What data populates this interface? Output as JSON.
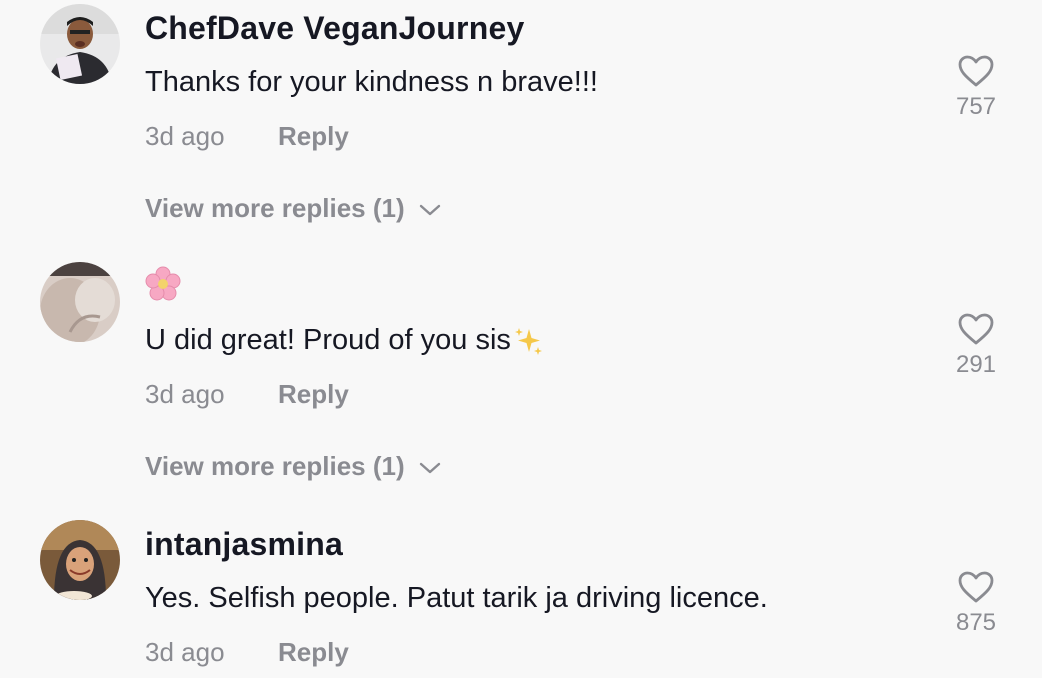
{
  "comments": [
    {
      "username": "ChefDave VeganJourney",
      "text": "Thanks for your kindness n brave!!!",
      "time": "3d ago",
      "reply_label": "Reply",
      "likes": "757",
      "view_more": "View more replies (1)"
    },
    {
      "username": "",
      "emoji": "cherry-blossom-icon",
      "text": "U did great! Proud of you sis",
      "text_emoji": "sparkles-icon",
      "time": "3d ago",
      "reply_label": "Reply",
      "likes": "291",
      "view_more": "View more replies (1)"
    },
    {
      "username": "intanjasmina",
      "text": "Yes. Selfish people. Patut tarik ja driving licence.",
      "time": "3d ago",
      "reply_label": "Reply",
      "likes": "875"
    }
  ],
  "colors": {
    "background": "#f8f8f8",
    "username": "#161823",
    "secondary": "#8a8b91"
  }
}
